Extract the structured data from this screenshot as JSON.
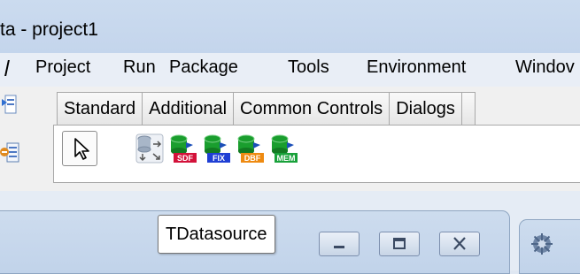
{
  "window": {
    "title": "ta - project1"
  },
  "menu": {
    "items": [
      {
        "label": "",
        "name": "menu-item-view"
      },
      {
        "label": "Project",
        "name": "menu-item-project"
      },
      {
        "label": "Run",
        "name": "menu-item-run"
      },
      {
        "label": "Package",
        "name": "menu-item-package"
      },
      {
        "label": "Tools",
        "name": "menu-item-tools"
      },
      {
        "label": "Environment",
        "name": "menu-item-environment"
      },
      {
        "label": "Windov",
        "name": "menu-item-window"
      }
    ]
  },
  "palette": {
    "tabs": [
      {
        "label": "Standard"
      },
      {
        "label": "Additional"
      },
      {
        "label": "Common Controls"
      },
      {
        "label": "Dialogs"
      }
    ],
    "components": [
      {
        "name": "tdatasource-component",
        "label": ""
      },
      {
        "name": "tsdfdataset-component",
        "label": "SDF"
      },
      {
        "name": "tfixedformatdataset-component",
        "label": "FIX"
      },
      {
        "name": "tdbf-component",
        "label": "DBF"
      },
      {
        "name": "tmemdataset-component",
        "label": "MEM"
      }
    ]
  },
  "tooltip": {
    "text": "TDatasource"
  },
  "colors": {
    "titlebar": "#c4d5ec",
    "sdf": "#d3113a",
    "fix": "#1f3fd4",
    "dbf": "#ee8a11",
    "mem": "#18a13a",
    "db_green": "#1a9e2e"
  }
}
